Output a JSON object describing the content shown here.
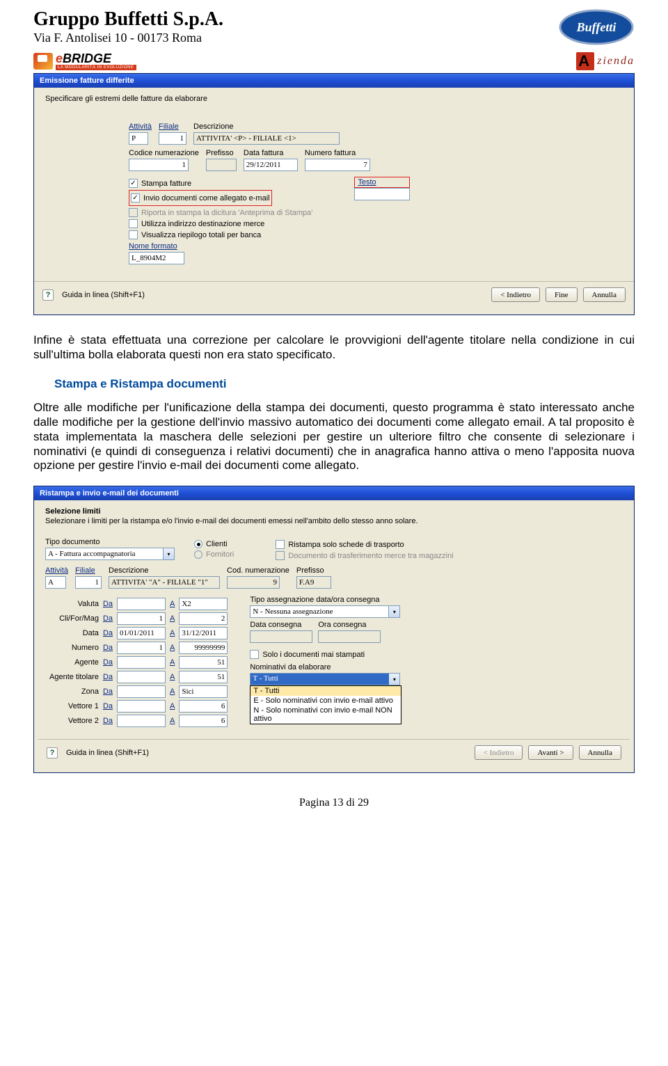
{
  "header": {
    "company": "Gruppo Buffetti S.p.A.",
    "address": "Via F. Antolisei 10 - 00173 Roma"
  },
  "logos": {
    "ebridge_e": "e",
    "ebridge_rest": "BRIDGE",
    "ebridge_tag": "LA MODULARITÀ IN EVOLUZIONE",
    "azienda": "zienda",
    "buffetti": "Buffetti"
  },
  "win1": {
    "title": "Emissione fatture differite",
    "instr": "Specificare gli estremi delle fatture da elaborare",
    "labels": {
      "attivita": "Attività",
      "filiale": "Filiale",
      "descr": "Descrizione",
      "codnum": "Codice numerazione",
      "prefisso": "Prefisso",
      "datafatt": "Data fattura",
      "numfatt": "Numero fattura",
      "nomeformato": "Nome formato",
      "testo": "Testo"
    },
    "vals": {
      "attivita": "P",
      "filiale": "1",
      "descr": "ATTIVITA' <P> - FILIALE <1>",
      "codnum": "1",
      "prefisso": "",
      "datafatt": "29/12/2011",
      "numfatt": "7",
      "nomeformato": "L_8904M2",
      "testo": ""
    },
    "checks": {
      "stampa": "Stampa fatture",
      "invio": "Invio documenti come allegato e-mail",
      "riporta": "Riporta in stampa la dicitura 'Anteprima di Stampa'",
      "indirizzo": "Utilizza indirizzo destinazione merce",
      "riepilogo": "Visualizza riepilogo totali per banca"
    },
    "btns": {
      "help": "Guida in linea (Shift+F1)",
      "indietro": "< Indietro",
      "fine": "Fine",
      "annulla": "Annulla"
    }
  },
  "para1": "Infine è stata effettuata una correzione per calcolare le provvigioni dell'agente titolare nella condizione in cui sull'ultima bolla elaborata questi non era stato specificato.",
  "section": "Stampa e Ristampa documenti",
  "para2": "Oltre alle modifiche per l'unificazione della stampa dei documenti, questo programma è stato interessato anche dalle modifiche per la gestione dell'invio massivo automatico dei documenti come allegato email. A tal proposito è stata implementata la maschera delle selezioni per gestire un ulteriore filtro che consente di selezionare i nominativi (e quindi di conseguenza i relativi documenti) che in anagrafica hanno attiva o meno l'apposita nuova opzione per gestire l'invio e-mail dei documenti come allegato.",
  "win2": {
    "title": "Ristampa e invio e-mail dei documenti",
    "sel": "Selezione limiti",
    "instr": "Selezionare i limiti per la ristampa e/o l'invio e-mail dei documenti emessi nell'ambito dello stesso anno solare.",
    "labels": {
      "tipodoc": "Tipo documento",
      "clienti": "Clienti",
      "fornitori": "Fornitori",
      "ristampa": "Ristampa solo schede di trasporto",
      "doctrasf": "Documento di trasferimento merce tra magazzini",
      "attivita": "Attività",
      "filiale": "Filiale",
      "descr": "Descrizione",
      "codnum": "Cod. numerazione",
      "prefisso": "Prefisso",
      "valuta": "Valuta",
      "cfm": "Cli/For/Mag",
      "data": "Data",
      "numero": "Numero",
      "agente": "Agente",
      "agentetit": "Agente titolare",
      "zona": "Zona",
      "vettore1": "Vettore 1",
      "vettore2": "Vettore 2",
      "da": "Da",
      "a": "A",
      "tipoass": "Tipo assegnazione data/ora consegna",
      "datacons": "Data consegna",
      "oracons": "Ora consegna",
      "solo": "Solo i documenti mai stampati",
      "nomelab": "Nominativi da elaborare"
    },
    "vals": {
      "tipodoc": "A - Fattura accompagnatoria",
      "attivita": "A",
      "filiale": "1",
      "descr": "ATTIVITA' \"A\" - FILIALE \"1\"",
      "codnum": "9",
      "prefisso": "F.A9",
      "valuta_a": "X2",
      "cfm_da": "1",
      "cfm_a": "2",
      "data_da": "01/01/2011",
      "data_a": "31/12/2011",
      "num_da": "1",
      "num_a": "99999999",
      "agente_a": "51",
      "agentetit_a": "51",
      "zona_a": "Sici",
      "vett1_a": "6",
      "vett2_a": "6",
      "tipoass": "N - Nessuna assegnazione",
      "nomsel": "T - Tutti"
    },
    "ddopts": {
      "o1": "T - Tutti",
      "o2": "E - Solo nominativi con invio e-mail attivo",
      "o3": "N - Solo nominativi con invio e-mail NON attivo"
    },
    "btns": {
      "help": "Guida in linea (Shift+F1)",
      "indietro": "< Indietro",
      "avanti": "Avanti >",
      "annulla": "Annulla"
    }
  },
  "footer": "Pagina 13 di 29"
}
